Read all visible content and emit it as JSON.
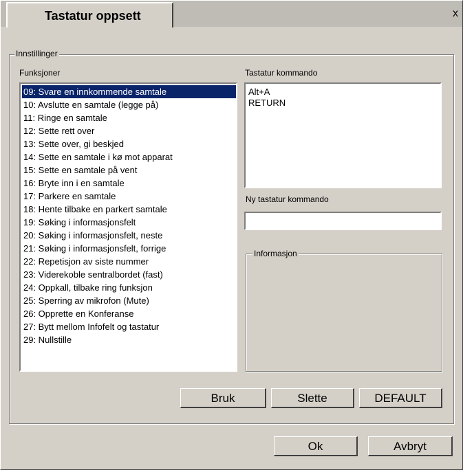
{
  "dialog": {
    "title": "Tastatur oppsett",
    "close_glyph": "x"
  },
  "settings": {
    "legend": "Innstillinger",
    "functions_label": "Funksjoner",
    "functions": [
      "09: Svare en innkommende samtale",
      "10: Avslutte en samtale (legge på)",
      "11: Ringe en samtale",
      "12: Sette rett over",
      "13: Sette over, gi beskjed",
      "14: Sette en samtale i kø mot apparat",
      "15: Sette en samtale på vent",
      "16: Bryte inn i en samtale",
      "17: Parkere en samtale",
      "18: Hente tilbake en parkert samtale",
      "19: Søking i informasjonsfelt",
      "20: Søking i informasjonsfelt, neste",
      "21: Søking i informasjonsfelt, forrige",
      "22: Repetisjon av siste nummer",
      "23: Viderekoble sentralbordet (fast)",
      "24: Oppkall, tilbake ring funksjon",
      "25: Sperring av mikrofon (Mute)",
      "26: Opprette en Konferanse",
      "27: Bytt mellom Infofelt og tastatur",
      "29: Nullstille"
    ],
    "selected_index": 0,
    "command_label": "Tastatur kommando",
    "commands": [
      "Alt+A",
      "RETURN"
    ],
    "new_command_label": "Ny tastatur kommando",
    "new_command_value": "",
    "info_legend": "Informasjon",
    "buttons": {
      "apply": "Bruk",
      "delete": "Slette",
      "default": "DEFAULT"
    }
  },
  "footer": {
    "ok": "Ok",
    "cancel": "Avbryt"
  }
}
